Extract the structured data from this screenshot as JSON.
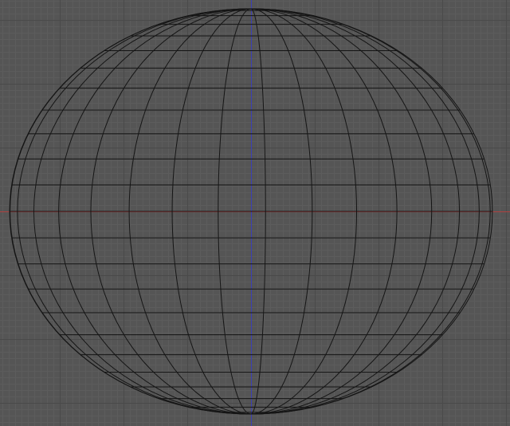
{
  "viewport": {
    "view": "orthographic-front",
    "background_color": "#555555",
    "grid": {
      "minor_color": "#5c5c5c",
      "major_color": "#4a4a4a",
      "minor_every": 1,
      "major_every": 10
    },
    "axes": {
      "x_axis_color": "#b0403f",
      "z_axis_color": "#3b3fb5"
    },
    "mesh": {
      "type": "uv-sphere-wireframe",
      "wire_color": "#151515",
      "horizontal_rings": 24,
      "vertical_segments": 32
    }
  }
}
